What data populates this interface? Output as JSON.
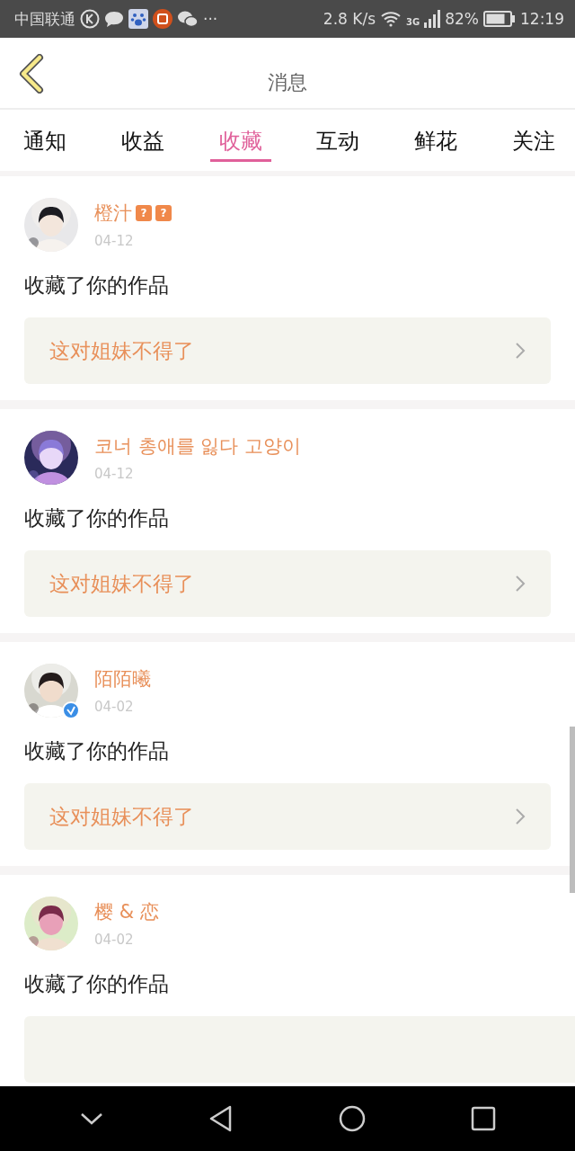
{
  "status_bar": {
    "carrier": "中国联通",
    "more": "···",
    "speed": "2.8 K/s",
    "network": "3G",
    "battery": "82%",
    "time": "12:19"
  },
  "header": {
    "title": "消息"
  },
  "tabs": [
    {
      "label": "通知",
      "selected": false
    },
    {
      "label": "收益",
      "selected": false
    },
    {
      "label": "收藏",
      "selected": true
    },
    {
      "label": "互动",
      "selected": false
    },
    {
      "label": "鲜花",
      "selected": false
    },
    {
      "label": "关注",
      "selected": false
    }
  ],
  "notifications": [
    {
      "name": "橙汁",
      "badges": [
        "?",
        "?"
      ],
      "verified": false,
      "date": "04-12",
      "action": "收藏了你的作品",
      "work": "这对姐妹不得了"
    },
    {
      "name": "코너 총애를 잃다 고양이",
      "verified": false,
      "date": "04-12",
      "action": "收藏了你的作品",
      "work": "这对姐妹不得了"
    },
    {
      "name": "陌陌曦",
      "verified": true,
      "date": "04-02",
      "action": "收藏了你的作品",
      "work": "这对姐妹不得了"
    },
    {
      "name": "樱 & 恋",
      "verified": false,
      "date": "04-02",
      "action": "收藏了你的作品"
    }
  ]
}
